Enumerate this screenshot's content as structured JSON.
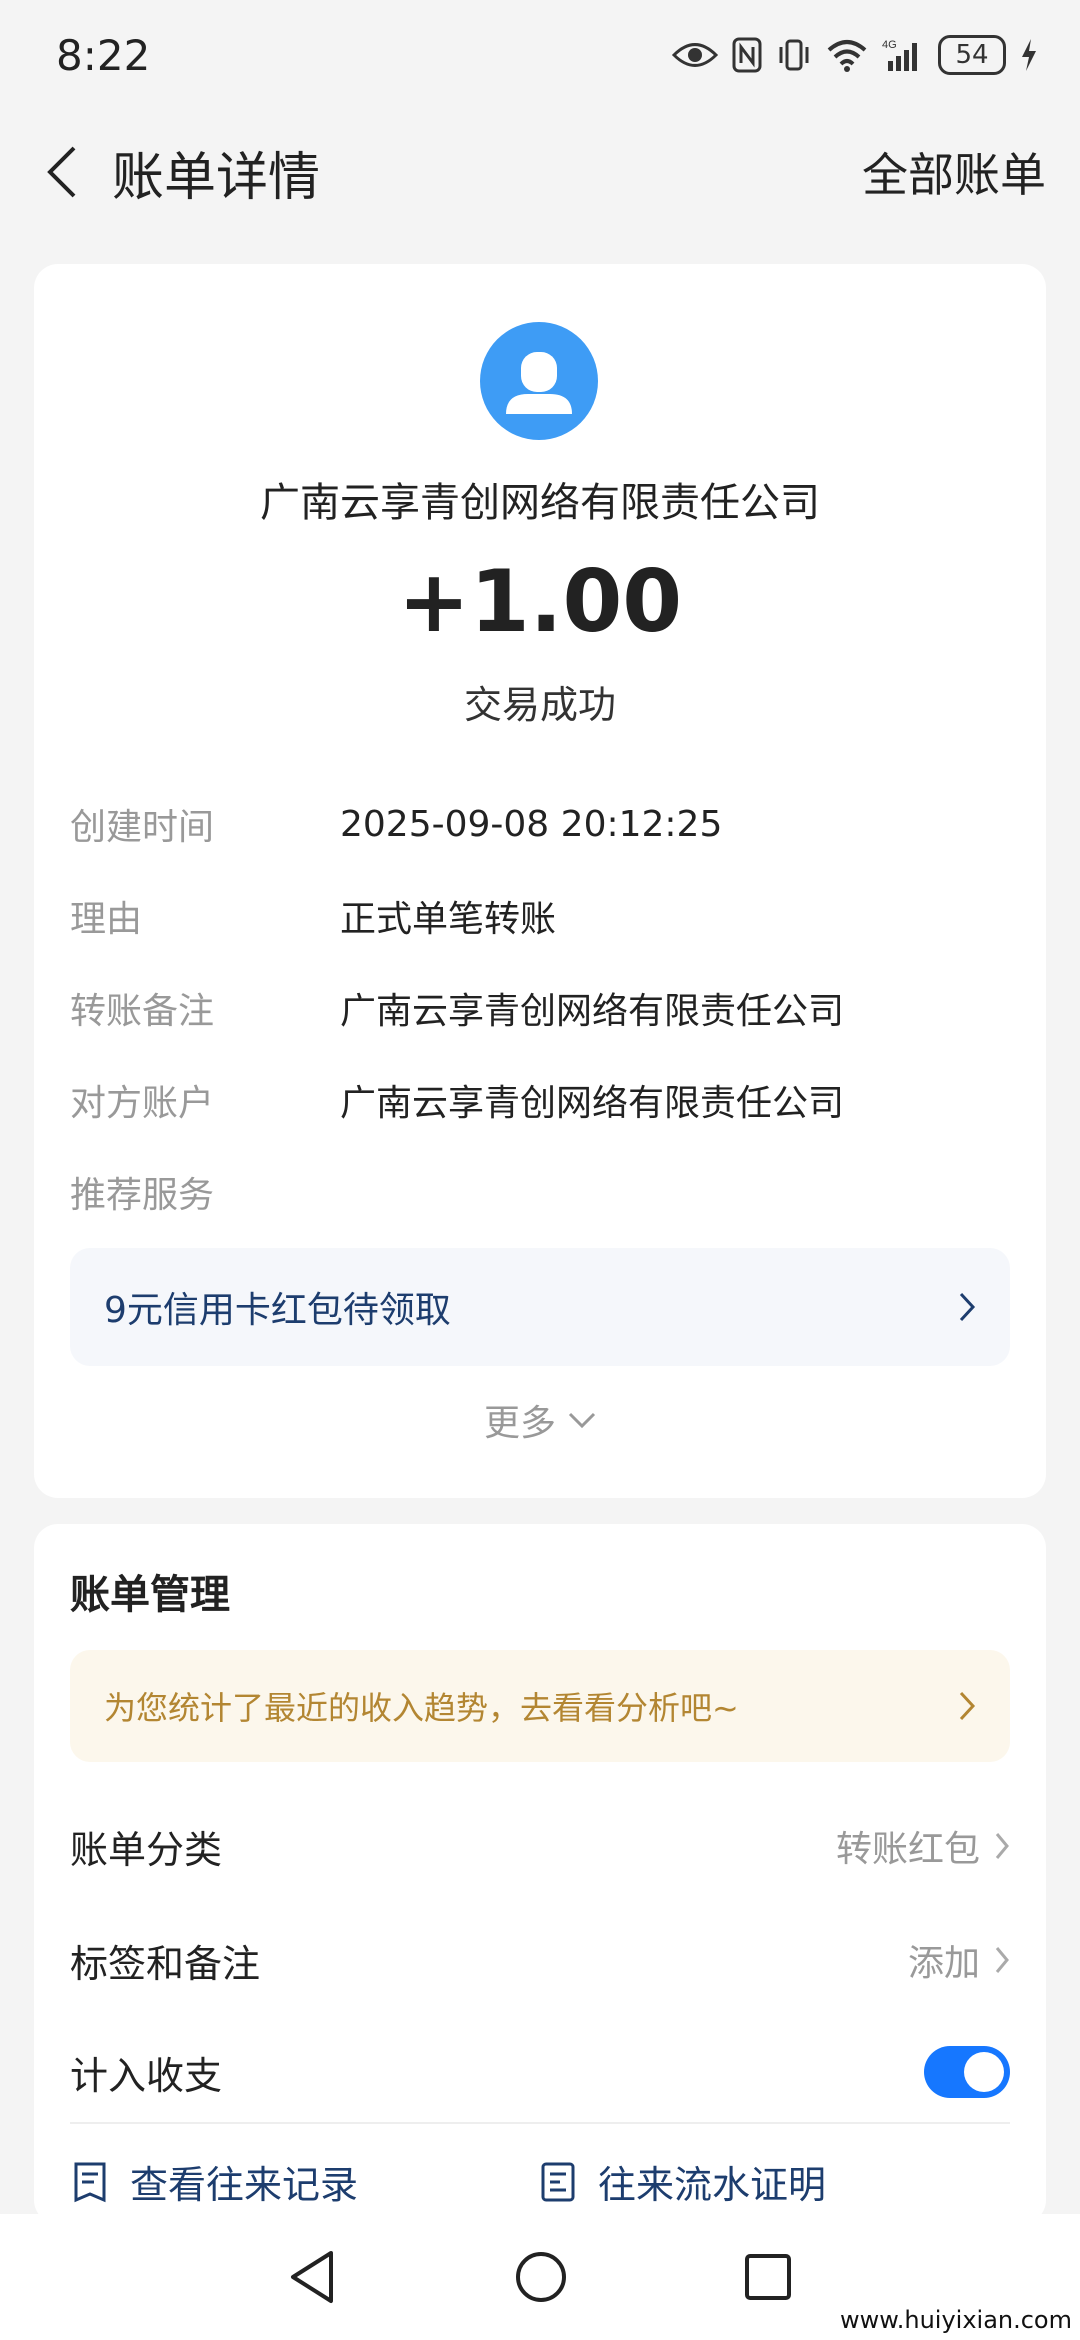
{
  "status_bar": {
    "time": "8:22",
    "battery": "54"
  },
  "nav": {
    "title": "账单详情",
    "all_bills": "全部账单"
  },
  "summary": {
    "merchant": "广南云享青创网络有限责任公司",
    "amount": "+1.00",
    "status": "交易成功"
  },
  "details": [
    {
      "label": "创建时间",
      "value": "2025-09-08 20:12:25"
    },
    {
      "label": "理由",
      "value": "正式单笔转账"
    },
    {
      "label": "转账备注",
      "value": "广南云享青创网络有限责任公司"
    },
    {
      "label": "对方账户",
      "value": "广南云享青创网络有限责任公司"
    },
    {
      "label": "推荐服务",
      "value": ""
    }
  ],
  "promo": {
    "text": "9元信用卡红包待领取"
  },
  "more": {
    "label": "更多"
  },
  "management": {
    "title": "账单管理",
    "insight": "为您统计了最近的收入趋势，去看看分析吧~",
    "category": {
      "label": "账单分类",
      "value": "转账红包"
    },
    "tags": {
      "label": "标签和备注",
      "value": "添加"
    },
    "include": {
      "label": "计入收支",
      "enabled": true
    },
    "actions": {
      "records": "查看往来记录",
      "proof": "往来流水证明"
    }
  },
  "watermark": "www.huiyixian.com",
  "colors": {
    "accent": "#1677ff",
    "avatar": "#3e9cf5",
    "insight_text": "#b38632",
    "promo_text": "#1d3d6e"
  }
}
